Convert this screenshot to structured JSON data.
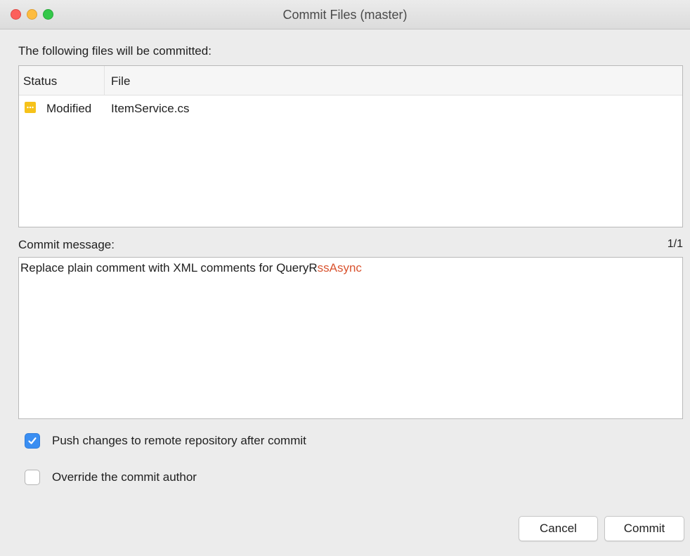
{
  "window": {
    "title": "Commit Files (master)"
  },
  "files_section": {
    "label": "The following files will be committed:",
    "columns": {
      "status": "Status",
      "file": "File"
    },
    "rows": [
      {
        "status": "Modified",
        "status_icon": "modified-icon",
        "status_color": "#f6c21a",
        "file": "ItemService.cs"
      }
    ]
  },
  "commit_message": {
    "label": "Commit message:",
    "counter": "1/1",
    "text_main": "Replace plain comment with XML comments for QueryR",
    "text_flagged": "ssAsync",
    "flagged_color": "#d9532f"
  },
  "options": {
    "push_label": "Push changes to remote repository after commit",
    "push_checked": true,
    "override_label": "Override the commit author",
    "override_checked": false
  },
  "buttons": {
    "cancel": "Cancel",
    "commit": "Commit"
  },
  "colors": {
    "accent": "#3a8ef2",
    "close": "#fc605c",
    "minimize": "#fdbc40",
    "zoom": "#34c84a"
  }
}
